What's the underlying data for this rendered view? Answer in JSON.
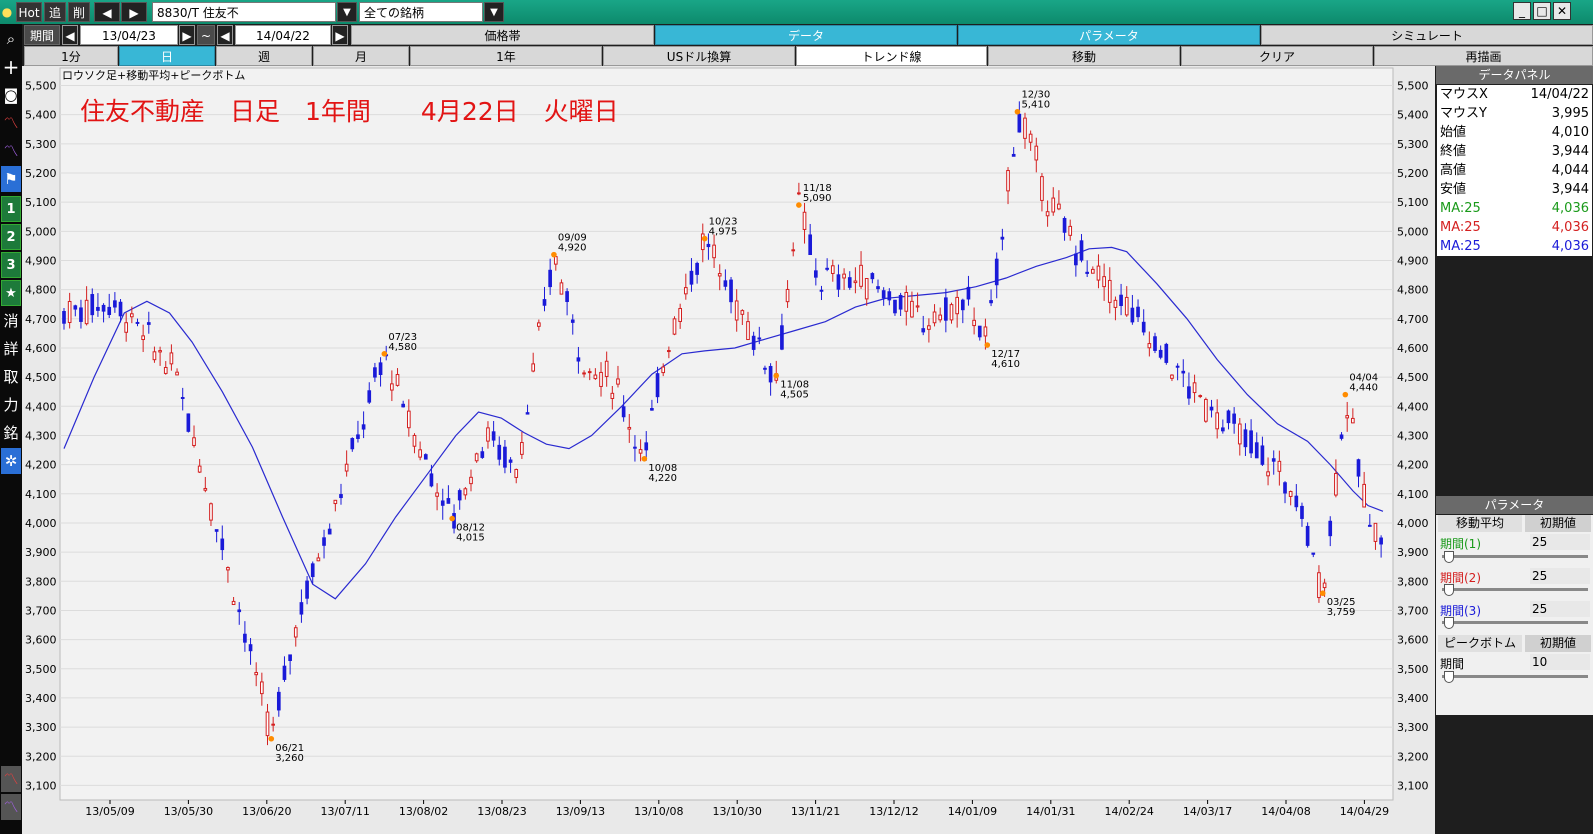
{
  "toolbar": {
    "hot": "Hot",
    "add": "追",
    "del": "削",
    "prev": "◀",
    "next": "▶",
    "symbol": "8830/T 住友不",
    "dropdown": "▼",
    "universe": "全ての銘柄"
  },
  "period": {
    "label": "期間",
    "from": "13/04/23",
    "tilde": "~",
    "to": "14/04/22"
  },
  "tabs_row1": [
    "価格帯",
    "データ",
    "パラメータ",
    "シミュレート"
  ],
  "tabs_row2": [
    "1分",
    "日",
    "週",
    "月",
    "1年",
    "USドル換算",
    "トレンド線",
    "移動",
    "クリア",
    "再描画"
  ],
  "leftbar_text": [
    "消",
    "詳",
    "取",
    "力",
    "銘"
  ],
  "leftbar_nums": [
    "1",
    "2",
    "3"
  ],
  "chart": {
    "legend": "ロウソク足+移動平均+ピークボトム",
    "title": "住友不動産　日足　1年間　　4月22日　火曜日",
    "yticks": [
      "5,500",
      "5,400",
      "5,300",
      "5,200",
      "5,100",
      "5,000",
      "4,900",
      "4,800",
      "4,700",
      "4,600",
      "4,500",
      "4,400",
      "4,300",
      "4,200",
      "4,100",
      "4,000",
      "3,900",
      "3,800",
      "3,700",
      "3,600",
      "3,500",
      "3,400",
      "3,300",
      "3,200",
      "3,100"
    ],
    "xticks": [
      "13/05/09",
      "13/05/30",
      "13/06/20",
      "13/07/11",
      "13/08/02",
      "13/08/23",
      "13/09/13",
      "13/10/08",
      "13/10/30",
      "13/11/21",
      "13/12/12",
      "14/01/09",
      "14/01/31",
      "14/02/24",
      "14/03/17",
      "14/04/08",
      "14/04/29"
    ],
    "peaks": [
      {
        "date": "07/23",
        "value": "4,580"
      },
      {
        "date": "09/09",
        "value": "4,920"
      },
      {
        "date": "10/23",
        "value": "4,975"
      },
      {
        "date": "11/18",
        "value": "5,090"
      },
      {
        "date": "12/30",
        "value": "5,410"
      },
      {
        "date": "04/04",
        "value": "4,440"
      }
    ],
    "bottoms": [
      {
        "date": "06/21",
        "value": "3,260"
      },
      {
        "date": "08/12",
        "value": "4,015"
      },
      {
        "date": "10/08",
        "value": "4,220"
      },
      {
        "date": "11/08",
        "value": "4,505"
      },
      {
        "date": "12/17",
        "value": "4,610"
      },
      {
        "date": "03/25",
        "value": "3,759"
      }
    ]
  },
  "chart_data": {
    "type": "candlestick",
    "ylim": [
      3050,
      5560
    ],
    "up_color": "#d42020",
    "down_color": "#1a1ad8",
    "ma_color": "#2a2ad0",
    "peak_marker_color": "#ff8c00",
    "ma_period": 25,
    "ma": [
      [
        0,
        4255
      ],
      [
        8,
        4500
      ],
      [
        16,
        4720
      ],
      [
        22,
        4760
      ],
      [
        28,
        4720
      ],
      [
        34,
        4620
      ],
      [
        42,
        4450
      ],
      [
        50,
        4260
      ],
      [
        58,
        4020
      ],
      [
        66,
        3790
      ],
      [
        72,
        3740
      ],
      [
        80,
        3860
      ],
      [
        88,
        4020
      ],
      [
        96,
        4160
      ],
      [
        104,
        4300
      ],
      [
        110,
        4380
      ],
      [
        116,
        4360
      ],
      [
        122,
        4310
      ],
      [
        128,
        4270
      ],
      [
        134,
        4255
      ],
      [
        140,
        4300
      ],
      [
        148,
        4400
      ],
      [
        156,
        4510
      ],
      [
        164,
        4580
      ],
      [
        170,
        4590
      ],
      [
        178,
        4600
      ],
      [
        186,
        4630
      ],
      [
        194,
        4660
      ],
      [
        202,
        4690
      ],
      [
        210,
        4740
      ],
      [
        218,
        4770
      ],
      [
        226,
        4780
      ],
      [
        234,
        4790
      ],
      [
        242,
        4810
      ],
      [
        250,
        4840
      ],
      [
        258,
        4880
      ],
      [
        266,
        4910
      ],
      [
        272,
        4940
      ],
      [
        278,
        4945
      ],
      [
        282,
        4930
      ],
      [
        290,
        4820
      ],
      [
        298,
        4700
      ],
      [
        306,
        4560
      ],
      [
        314,
        4440
      ],
      [
        322,
        4340
      ],
      [
        330,
        4280
      ],
      [
        336,
        4200
      ],
      [
        342,
        4110
      ],
      [
        346,
        4060
      ],
      [
        350,
        4040
      ]
    ],
    "peaks": [
      [
        85,
        4580
      ],
      [
        130,
        4920
      ],
      [
        170,
        4975
      ],
      [
        195,
        5090
      ],
      [
        253,
        5410
      ],
      [
        340,
        4440
      ]
    ],
    "bottoms": [
      [
        55,
        3260
      ],
      [
        103,
        4015
      ],
      [
        154,
        4220
      ],
      [
        189,
        4505
      ],
      [
        245,
        4610
      ],
      [
        334,
        3759
      ]
    ]
  },
  "data_panel": {
    "title": "データパネル",
    "rows": [
      {
        "k": "マウスX",
        "v": "14/04/22"
      },
      {
        "k": "マウスY",
        "v": "3,995"
      },
      {
        "k": "始値",
        "v": "4,010"
      },
      {
        "k": "終値",
        "v": "3,944"
      },
      {
        "k": "高値",
        "v": "4,044"
      },
      {
        "k": "安値",
        "v": "3,944"
      }
    ],
    "ma_rows": [
      {
        "k": "MA:25",
        "v": "4,036",
        "color": "#1a9a1a"
      },
      {
        "k": "MA:25",
        "v": "4,036",
        "color": "#d42020"
      },
      {
        "k": "MA:25",
        "v": "4,036",
        "color": "#1a1ad8"
      }
    ]
  },
  "param_panel": {
    "title": "パラメータ",
    "ma_tab": "移動平均",
    "reset": "初期値",
    "periods": [
      {
        "label": "期間(1)",
        "value": "25",
        "color": "#1a9a1a"
      },
      {
        "label": "期間(2)",
        "value": "25",
        "color": "#d42020"
      },
      {
        "label": "期間(3)",
        "value": "25",
        "color": "#1a1ad8"
      }
    ],
    "pb_tab": "ピークボトム",
    "pb_label": "期間",
    "pb_value": "10"
  }
}
